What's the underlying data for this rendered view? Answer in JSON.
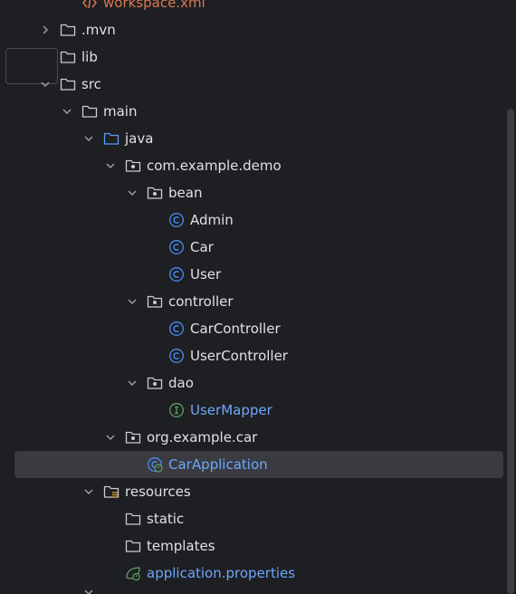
{
  "colors": {
    "background": "#1e1f22",
    "text": "#dfe1e5",
    "link_blue": "#6ea6ff",
    "xml_orange": "#d97752",
    "class_icon": "#4a8bf5",
    "interface_icon": "#5aa160",
    "selection": "#393b40"
  },
  "tree": {
    "items": [
      {
        "label": "workspace.xml",
        "icon": "xml-icon",
        "style": "orange",
        "chevron": "none"
      },
      {
        "label": ".mvn",
        "icon": "folder-icon",
        "style": "normal",
        "chevron": "right"
      },
      {
        "label": "lib",
        "icon": "folder-icon",
        "style": "normal",
        "chevron": "none"
      },
      {
        "label": "src",
        "icon": "folder-icon",
        "style": "normal",
        "chevron": "down"
      },
      {
        "label": "main",
        "icon": "folder-icon",
        "style": "normal",
        "chevron": "down"
      },
      {
        "label": "java",
        "icon": "source-folder-icon",
        "style": "normal",
        "chevron": "down"
      },
      {
        "label": "com.example.demo",
        "icon": "package-icon",
        "style": "normal",
        "chevron": "down"
      },
      {
        "label": "bean",
        "icon": "package-icon",
        "style": "normal",
        "chevron": "down"
      },
      {
        "label": "Admin",
        "icon": "class-icon",
        "style": "normal",
        "chevron": "none"
      },
      {
        "label": "Car",
        "icon": "class-icon",
        "style": "normal",
        "chevron": "none"
      },
      {
        "label": "User",
        "icon": "class-icon",
        "style": "normal",
        "chevron": "none"
      },
      {
        "label": "controller",
        "icon": "package-icon",
        "style": "normal",
        "chevron": "down"
      },
      {
        "label": "CarController",
        "icon": "class-icon",
        "style": "normal",
        "chevron": "none"
      },
      {
        "label": "UserController",
        "icon": "class-icon",
        "style": "normal",
        "chevron": "none"
      },
      {
        "label": "dao",
        "icon": "package-icon",
        "style": "normal",
        "chevron": "down"
      },
      {
        "label": "UserMapper",
        "icon": "interface-icon",
        "style": "blue",
        "chevron": "none"
      },
      {
        "label": "org.example.car",
        "icon": "package-icon",
        "style": "normal",
        "chevron": "down"
      },
      {
        "label": "CarApplication",
        "icon": "spring-boot-app-icon",
        "style": "blue",
        "chevron": "none",
        "selected": true
      },
      {
        "label": "resources",
        "icon": "resources-folder-icon",
        "style": "normal",
        "chevron": "down"
      },
      {
        "label": "static",
        "icon": "folder-icon",
        "style": "normal",
        "chevron": "none"
      },
      {
        "label": "templates",
        "icon": "folder-icon",
        "style": "normal",
        "chevron": "none"
      },
      {
        "label": "application.properties",
        "icon": "spring-properties-icon",
        "style": "blue",
        "chevron": "none"
      }
    ]
  }
}
